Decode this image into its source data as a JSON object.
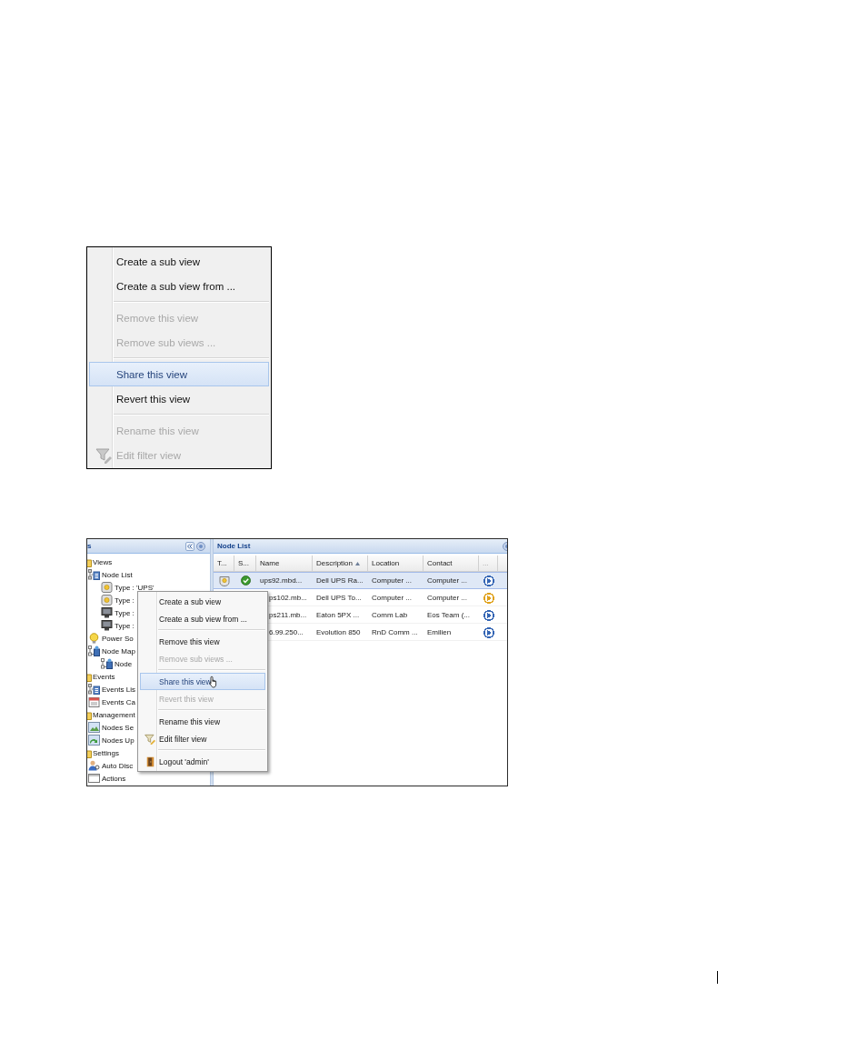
{
  "menu_figure": {
    "items": [
      {
        "kind": "item",
        "label": "Create a sub view",
        "disabled": false,
        "selected": false
      },
      {
        "kind": "item",
        "label": "Create a sub view from ...",
        "disabled": false,
        "selected": false
      },
      {
        "kind": "separator"
      },
      {
        "kind": "item",
        "label": "Remove this view",
        "disabled": true,
        "selected": false
      },
      {
        "kind": "item",
        "label": "Remove sub views ...",
        "disabled": true,
        "selected": false
      },
      {
        "kind": "separator"
      },
      {
        "kind": "item",
        "label": "Share this view",
        "disabled": false,
        "selected": true
      },
      {
        "kind": "item",
        "label": "Revert this view",
        "disabled": false,
        "selected": false
      },
      {
        "kind": "separator"
      },
      {
        "kind": "item",
        "label": "Rename this view",
        "disabled": true,
        "selected": false
      },
      {
        "kind": "filter",
        "label": "Edit filter view",
        "disabled": true,
        "selected": false
      }
    ]
  },
  "app_figure": {
    "tree_panel": {
      "title": "s",
      "tree": [
        {
          "label": "Views",
          "kind": "folder",
          "children": [
            {
              "label": "Node List",
              "kind": "tree_list",
              "children": [
                {
                  "label": "Type : 'UPS'",
                  "kind": "ups"
                },
                {
                  "label": "Type :",
                  "kind": "ups"
                },
                {
                  "label": "Type :",
                  "kind": "server"
                },
                {
                  "label": "Type :",
                  "kind": "server"
                }
              ]
            },
            {
              "label": "Power So",
              "kind": "bulb"
            },
            {
              "label": "Node Map",
              "kind": "network",
              "children": [
                {
                  "label": "Node",
                  "kind": "network"
                }
              ]
            }
          ]
        },
        {
          "label": "Events",
          "kind": "folder",
          "children": [
            {
              "label": "Events Lis",
              "kind": "tree_list"
            },
            {
              "label": "Events Ca",
              "kind": "calendar"
            }
          ]
        },
        {
          "label": "Management",
          "kind": "folder",
          "children": [
            {
              "label": "Nodes Se",
              "kind": "nodes"
            },
            {
              "label": "Nodes Up",
              "kind": "nodes_update"
            }
          ]
        },
        {
          "label": "Settings",
          "kind": "folder",
          "children": [
            {
              "label": "Auto Disc",
              "kind": "person"
            },
            {
              "label": "Actions",
              "kind": "window"
            }
          ]
        }
      ]
    },
    "node_list": {
      "title": "Node List",
      "columns": [
        {
          "label": "T...",
          "sorted": false
        },
        {
          "label": "S...",
          "sorted": false
        },
        {
          "label": "Name",
          "sorted": false
        },
        {
          "label": "Description",
          "sorted": true
        },
        {
          "label": "Location",
          "sorted": false
        },
        {
          "label": "Contact",
          "sorted": false
        },
        {
          "label": "...",
          "sorted": false
        }
      ],
      "rows": [
        {
          "kind": "full",
          "selected": true,
          "name": "ups92.mbd...",
          "description": "Dell UPS Ra...",
          "location": "Computer ...",
          "contact": "Computer ...",
          "color": "#3465b4"
        },
        {
          "kind": "covered",
          "selected": false,
          "name": "ps102.mb...",
          "description": "Dell UPS To...",
          "location": "Computer ...",
          "contact": "Computer ...",
          "color": "#e0a21c"
        },
        {
          "kind": "covered",
          "selected": false,
          "name": "ps211.mb...",
          "description": "Eaton 5PX ...",
          "location": "Comm Lab",
          "contact": "Eos Team (...",
          "color": "#3465b4"
        },
        {
          "kind": "covered",
          "selected": false,
          "name": "6.99.250...",
          "description": "Evolution 850",
          "location": "RnD Comm ...",
          "contact": "Emilien",
          "color": "#3465b4"
        }
      ]
    },
    "context_menu": {
      "items": [
        {
          "kind": "item",
          "label": "Create a sub view",
          "disabled": false,
          "selected": false,
          "cursor": false
        },
        {
          "kind": "item",
          "label": "Create a sub view from ...",
          "disabled": false,
          "selected": false,
          "cursor": false
        },
        {
          "kind": "separator"
        },
        {
          "kind": "item",
          "label": "Remove this view",
          "disabled": false,
          "selected": false,
          "cursor": false
        },
        {
          "kind": "item",
          "label": "Remove sub views ...",
          "disabled": true,
          "selected": false,
          "cursor": false
        },
        {
          "kind": "separator"
        },
        {
          "kind": "item",
          "label": "Share this view",
          "disabled": false,
          "selected": true,
          "cursor": true
        },
        {
          "kind": "item",
          "label": "Revert this view",
          "disabled": true,
          "selected": false,
          "cursor": false
        },
        {
          "kind": "separator"
        },
        {
          "kind": "item",
          "label": "Rename this view",
          "disabled": false,
          "selected": false,
          "cursor": false
        },
        {
          "kind": "filter",
          "label": "Edit filter view",
          "disabled": false,
          "selected": false,
          "cursor": false
        },
        {
          "kind": "separator"
        },
        {
          "kind": "logout",
          "label": "Logout 'admin'",
          "disabled": false,
          "selected": false,
          "cursor": false
        }
      ]
    }
  }
}
